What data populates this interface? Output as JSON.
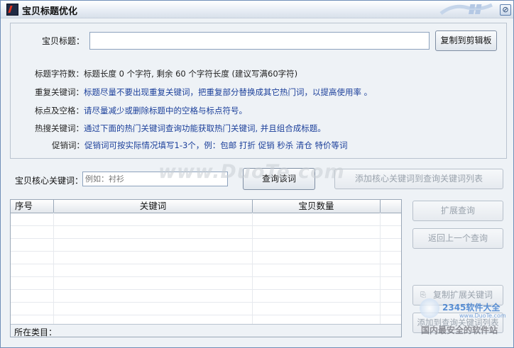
{
  "window": {
    "title": "宝贝标题优化",
    "close_glyph": "⊘"
  },
  "title_input": {
    "label": "宝贝标题：",
    "value": "",
    "copy_button": "复制到剪辑板"
  },
  "hints": [
    {
      "key": "标题字符数：",
      "text": "标题长度 0 个字符, 剩余 60 个字符长度 (建议写满60字符)",
      "color": "#222222"
    },
    {
      "key": "重复关键词：",
      "text": "标题尽量不要出现重复关键词，把重复部分替换成其它热门词，以提高使用率 。",
      "color": "#1b3f9a"
    },
    {
      "key": "标点及空格：",
      "text": "请尽量减少或删除标题中的空格与标点符号。",
      "color": "#1b3f9a"
    },
    {
      "key": "热搜关键词：",
      "text": "通过下面的热门关键词查询功能获取热门关键词, 并且组合成标题。",
      "color": "#1b3f9a"
    },
    {
      "key": "促销词：",
      "text": "促销词可按实际情况填写1-3个，例：包邮 打折 促销 秒杀 清仓 特价等词",
      "color": "#1b3f9a"
    }
  ],
  "keyword_query": {
    "label": "宝贝核心关键词：",
    "placeholder": "例如：衬衫",
    "query_button": "查询该词",
    "add_button": "添加核心关键词到查询关键词列表"
  },
  "table": {
    "columns": [
      "序号",
      "关键词",
      "宝贝数量"
    ],
    "rows": [],
    "footer_label": "所在类目："
  },
  "side_buttons": {
    "expand": "扩展查询",
    "back": "返回上一个查询",
    "copy_expanded": "复制扩展关键词",
    "add_to_list": "添加到查询关键词列表"
  },
  "watermarks": {
    "main": "www.DuoTe.com",
    "corner_top": "2345软件大全",
    "corner_url": "www.DuoTe.com",
    "corner_bottom": "国内最安全的软件站"
  }
}
